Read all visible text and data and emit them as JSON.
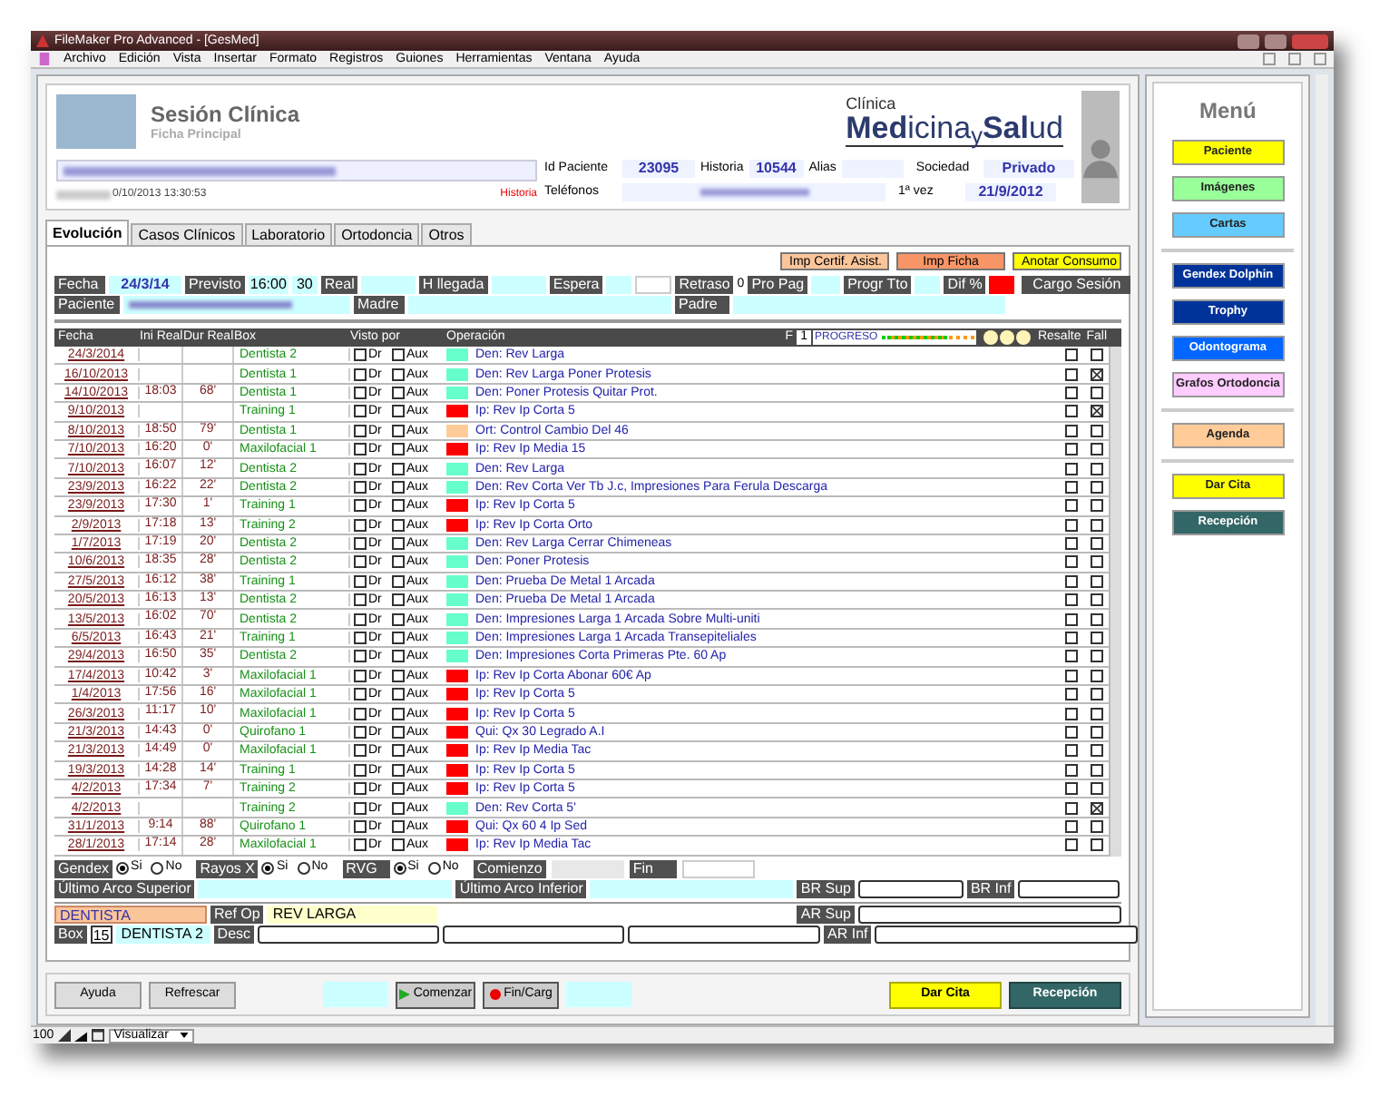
{
  "window": {
    "title": "FileMaker Pro Advanced - [GesMed]"
  },
  "menu_bar": [
    "Archivo",
    "Edición",
    "Vista",
    "Insertar",
    "Formato",
    "Registros",
    "Guiones",
    "Herramientas",
    "Ventana",
    "Ayuda"
  ],
  "header": {
    "title": "Sesión Clínica",
    "subtitle": "Ficha Principal",
    "clinic_label": "Clínica",
    "logo": "**Med**icina$_{y}$**Sal**ud",
    "timestamp": "0/10/2013 13:30:53",
    "history_link": "Historia",
    "id_paciente": {
      "label": "Id Paciente",
      "value": "23095"
    },
    "historia": {
      "label": "Historia",
      "value": "10544"
    },
    "alias": {
      "label": "Alias"
    },
    "sociedad": {
      "label": "Sociedad",
      "value": "Privado"
    },
    "telefonos": {
      "label": "Teléfonos"
    },
    "primera_vez": {
      "label": "1ª vez",
      "value": "21/9/2012"
    }
  },
  "tabs": [
    {
      "label": "Evolución",
      "selected": true
    },
    {
      "label": "Casos Clínicos",
      "selected": false
    },
    {
      "label": "Laboratorio",
      "selected": false
    },
    {
      "label": "Ortodoncia",
      "selected": false
    },
    {
      "label": "Otros",
      "selected": false
    }
  ],
  "action_buttons": [
    {
      "label": "Imp Certif. Asist.",
      "color": "#fbc59a"
    },
    {
      "label": "Imp Ficha",
      "color": "#f89566"
    },
    {
      "label": "Anotar Consumo",
      "color": "#ffff00"
    }
  ],
  "session": {
    "fecha": {
      "label": "Fecha",
      "value": "24/3/14"
    },
    "previsto": {
      "label": "Previsto",
      "time": "16:00",
      "minutes": "30"
    },
    "real": {
      "label": "Real"
    },
    "llegada": {
      "label": "H llegada"
    },
    "espera": {
      "label": "Espera"
    },
    "retraso": {
      "label": "Retraso",
      "value": "0"
    },
    "pro_pag": {
      "label": "Pro Pag"
    },
    "progr_tto": {
      "label": "Progr Tto"
    },
    "dif": {
      "label": "Dif %"
    },
    "cargo": {
      "label": "Cargo Sesión"
    },
    "paciente": {
      "label": "Paciente"
    },
    "madre": {
      "label": "Madre"
    },
    "padre": {
      "label": "Padre"
    }
  },
  "table": {
    "columns": [
      "Fecha",
      "Ini Real",
      "Dur Real",
      "Box",
      "Visto por",
      "Operación"
    ],
    "f_label": "F",
    "f_value": "1",
    "progress": {
      "label": "PROGRESO",
      "level": 0.7
    },
    "resalte": "Resalte",
    "fall": "Fall",
    "rows": [
      {
        "fecha": "24/3/2014",
        "ini": "",
        "dur": "",
        "box": "Dentista 2",
        "visto": [
          {
            "label": "Dr",
            "checked": false
          },
          {
            "label": "Aux",
            "checked": false
          }
        ],
        "color": "#66ffcc",
        "op": "Den: Rev Larga",
        "resalte": false,
        "fall": false
      },
      {
        "fecha": "16/10/2013",
        "ini": "",
        "dur": "",
        "box": "Dentista 1",
        "visto": [
          {
            "label": "Dr",
            "checked": false
          },
          {
            "label": "Aux",
            "checked": false
          }
        ],
        "color": "#66ffcc",
        "op": "Den: Rev Larga Poner Protesis",
        "resalte": false,
        "fall": true
      },
      {
        "fecha": "14/10/2013",
        "ini": "18:03",
        "dur": "68'",
        "box": "Dentista 1",
        "visto": [
          {
            "label": "Dr",
            "checked": false
          },
          {
            "label": "Aux",
            "checked": false
          }
        ],
        "color": "#66ffcc",
        "op": "Den: Poner Protesis  Quitar Prot.",
        "resalte": false,
        "fall": false
      },
      {
        "fecha": "9/10/2013",
        "ini": "",
        "dur": "",
        "box": "Training 1",
        "visto": [
          {
            "label": "Dr",
            "checked": false
          },
          {
            "label": "Aux",
            "checked": false
          }
        ],
        "color": "#ff0000",
        "op": "Ip: Rev Ip Corta 5",
        "resalte": false,
        "fall": true
      },
      {
        "fecha": "8/10/2013",
        "ini": "18:50",
        "dur": "79'",
        "box": "Dentista 1",
        "visto": [
          {
            "label": "Dr",
            "checked": false
          },
          {
            "label": "Aux",
            "checked": false
          }
        ],
        "color": "#ffcc99",
        "op": "Ort: Control Cambio Del 46",
        "resalte": false,
        "fall": false
      },
      {
        "fecha": "7/10/2013",
        "ini": "16:20",
        "dur": "0'",
        "box": "Maxilofacial 1",
        "visto": [
          {
            "label": "Dr",
            "checked": false
          },
          {
            "label": "Aux",
            "checked": false
          }
        ],
        "color": "#ff0000",
        "op": "Ip: Rev Ip Media 15",
        "resalte": false,
        "fall": false
      },
      {
        "fecha": "7/10/2013",
        "ini": "16:07",
        "dur": "12'",
        "box": "Dentista 2",
        "visto": [
          {
            "label": "Dr",
            "checked": false
          },
          {
            "label": "Aux",
            "checked": false
          }
        ],
        "color": "#66ffcc",
        "op": "Den: Rev Larga",
        "resalte": false,
        "fall": false
      },
      {
        "fecha": "23/9/2013",
        "ini": "16:22",
        "dur": "22'",
        "box": "Dentista 2",
        "visto": [
          {
            "label": "Dr",
            "checked": false
          },
          {
            "label": "Aux",
            "checked": false
          }
        ],
        "color": "#66ffcc",
        "op": "Den: Rev Corta Ver Tb J.c, Impresiones Para Ferula Descarga",
        "resalte": false,
        "fall": false
      },
      {
        "fecha": "23/9/2013",
        "ini": "17:30",
        "dur": "1'",
        "box": "Training 1",
        "visto": [
          {
            "label": "Dr",
            "checked": false
          },
          {
            "label": "Aux",
            "checked": false
          }
        ],
        "color": "#ff0000",
        "op": "Ip: Rev Ip Corta 5",
        "resalte": false,
        "fall": false
      },
      {
        "fecha": "2/9/2013",
        "ini": "17:18",
        "dur": "13'",
        "box": "Training 2",
        "visto": [
          {
            "label": "Dr",
            "checked": false
          },
          {
            "label": "Aux",
            "checked": false
          }
        ],
        "color": "#ff0000",
        "op": "Ip: Rev Ip Corta Orto",
        "resalte": false,
        "fall": false
      },
      {
        "fecha": "1/7/2013",
        "ini": "17:19",
        "dur": "20'",
        "box": "Dentista 2",
        "visto": [
          {
            "label": "Dr",
            "checked": false
          },
          {
            "label": "Aux",
            "checked": false
          }
        ],
        "color": "#66ffcc",
        "op": "Den: Rev Larga Cerrar Chimeneas",
        "resalte": false,
        "fall": false
      },
      {
        "fecha": "10/6/2013",
        "ini": "18:35",
        "dur": "28'",
        "box": "Dentista 2",
        "visto": [
          {
            "label": "Dr",
            "checked": false
          },
          {
            "label": "Aux",
            "checked": false
          }
        ],
        "color": "#66ffcc",
        "op": "Den: Poner Protesis",
        "resalte": false,
        "fall": false
      },
      {
        "fecha": "27/5/2013",
        "ini": "16:12",
        "dur": "38'",
        "box": "Training 1",
        "visto": [
          {
            "label": "Dr",
            "checked": false
          },
          {
            "label": "Aux",
            "checked": false
          }
        ],
        "color": "#66ffcc",
        "op": "Den: Prueba De Metal 1 Arcada",
        "resalte": false,
        "fall": false
      },
      {
        "fecha": "20/5/2013",
        "ini": "16:13",
        "dur": "13'",
        "box": "Dentista 2",
        "visto": [
          {
            "label": "Dr",
            "checked": false
          },
          {
            "label": "Aux",
            "checked": false
          }
        ],
        "color": "#66ffcc",
        "op": "Den: Prueba De Metal 1 Arcada",
        "resalte": false,
        "fall": false
      },
      {
        "fecha": "13/5/2013",
        "ini": "16:02",
        "dur": "70'",
        "box": "Dentista 2",
        "visto": [
          {
            "label": "Dr",
            "checked": false
          },
          {
            "label": "Aux",
            "checked": false
          }
        ],
        "color": "#66ffcc",
        "op": "Den: Impresiones Larga 1 Arcada Sobre Multi-uniti",
        "resalte": false,
        "fall": false
      },
      {
        "fecha": "6/5/2013",
        "ini": "16:43",
        "dur": "21'",
        "box": "Training 1",
        "visto": [
          {
            "label": "Dr",
            "checked": false
          },
          {
            "label": "Aux",
            "checked": false
          }
        ],
        "color": "#66ffcc",
        "op": "Den: Impresiones Larga 1 Arcada Transepiteliales",
        "resalte": false,
        "fall": false
      },
      {
        "fecha": "29/4/2013",
        "ini": "16:50",
        "dur": "35'",
        "box": "Dentista 2",
        "visto": [
          {
            "label": "Dr",
            "checked": false
          },
          {
            "label": "Aux",
            "checked": false
          }
        ],
        "color": "#66ffcc",
        "op": "Den: Impresiones Corta Primeras Pte. 60 Ap",
        "resalte": false,
        "fall": false
      },
      {
        "fecha": "17/4/2013",
        "ini": "10:42",
        "dur": "3'",
        "box": "Maxilofacial 1",
        "visto": [
          {
            "label": "Dr",
            "checked": false
          },
          {
            "label": "Aux",
            "checked": false
          }
        ],
        "color": "#ff0000",
        "op": "Ip: Rev Ip Corta Abonar 60€ Ap",
        "resalte": false,
        "fall": false
      },
      {
        "fecha": "1/4/2013",
        "ini": "17:56",
        "dur": "16'",
        "box": "Maxilofacial 1",
        "visto": [
          {
            "label": "Dr",
            "checked": false
          },
          {
            "label": "Aux",
            "checked": false
          }
        ],
        "color": "#ff0000",
        "op": "Ip: Rev Ip Corta 5",
        "resalte": false,
        "fall": false
      },
      {
        "fecha": "26/3/2013",
        "ini": "11:17",
        "dur": "10'",
        "box": "Maxilofacial 1",
        "visto": [
          {
            "label": "Dr",
            "checked": false
          },
          {
            "label": "Aux",
            "checked": false
          }
        ],
        "color": "#ff0000",
        "op": "Ip: Rev Ip Corta 5",
        "resalte": false,
        "fall": false
      },
      {
        "fecha": "21/3/2013",
        "ini": "14:43",
        "dur": "0'",
        "box": "Quirofano 1",
        "visto": [
          {
            "label": "Dr",
            "checked": false
          },
          {
            "label": "Aux",
            "checked": false
          }
        ],
        "color": "#ff0000",
        "op": "Qui: Qx 30 Legrado A.I",
        "resalte": false,
        "fall": false
      },
      {
        "fecha": "21/3/2013",
        "ini": "14:49",
        "dur": "0'",
        "box": "Maxilofacial 1",
        "visto": [
          {
            "label": "Dr",
            "checked": false
          },
          {
            "label": "Aux",
            "checked": false
          }
        ],
        "color": "#ff0000",
        "op": "Ip: Rev Ip Media Tac",
        "resalte": false,
        "fall": false
      },
      {
        "fecha": "19/3/2013",
        "ini": "14:28",
        "dur": "14'",
        "box": "Training 1",
        "visto": [
          {
            "label": "Dr",
            "checked": false
          },
          {
            "label": "Aux",
            "checked": false
          }
        ],
        "color": "#ff0000",
        "op": "Ip: Rev Ip Corta 5",
        "resalte": false,
        "fall": false
      },
      {
        "fecha": "4/2/2013",
        "ini": "17:34",
        "dur": "7'",
        "box": "Training 2",
        "visto": [
          {
            "label": "Dr",
            "checked": false
          },
          {
            "label": "Aux",
            "checked": false
          }
        ],
        "color": "#ff0000",
        "op": "Ip: Rev Ip Corta 5",
        "resalte": false,
        "fall": false
      },
      {
        "fecha": "4/2/2013",
        "ini": "",
        "dur": "",
        "box": "Training 2",
        "visto": [
          {
            "label": "Dr",
            "checked": false
          },
          {
            "label": "Aux",
            "checked": false
          }
        ],
        "color": "#66ffcc",
        "op": "Den: Rev Corta 5'",
        "resalte": false,
        "fall": true
      },
      {
        "fecha": "31/1/2013",
        "ini": "9:14",
        "dur": "88'",
        "box": "Quirofano 1",
        "visto": [
          {
            "label": "Dr",
            "checked": false
          },
          {
            "label": "Aux",
            "checked": false
          }
        ],
        "color": "#ff0000",
        "op": "Qui: Qx 60 4 Ip Sed",
        "resalte": false,
        "fall": false
      },
      {
        "fecha": "28/1/2013",
        "ini": "17:14",
        "dur": "28'",
        "box": "Maxilofacial 1",
        "visto": [
          {
            "label": "Dr",
            "checked": false
          },
          {
            "label": "Aux",
            "checked": false
          }
        ],
        "color": "#ff0000",
        "op": "Ip: Rev Ip Media Tac",
        "resalte": false,
        "fall": false
      }
    ]
  },
  "options": {
    "radios": [
      {
        "label": "Gendex",
        "choices": [
          {
            "label": "Si",
            "selected": true
          },
          {
            "label": "No",
            "selected": false
          }
        ]
      },
      {
        "label": "Rayos X",
        "choices": [
          {
            "label": "Si",
            "selected": true
          },
          {
            "label": "No",
            "selected": false
          }
        ]
      },
      {
        "label": "RVG",
        "choices": [
          {
            "label": "Si",
            "selected": true
          },
          {
            "label": "No",
            "selected": false
          }
        ]
      }
    ],
    "comienzo": "Comienzo",
    "fin": "Fin",
    "arco_superior": "Último Arco Superior",
    "arco_inferior": "Último Arco Inferior",
    "br_sup": "BR Sup",
    "br_inf": "BR Inf",
    "ar_sup": "AR Sup",
    "ar_inf": "AR Inf",
    "role": "DENTISTA",
    "ref_op": {
      "label": "Ref Op",
      "value": "REV LARGA"
    },
    "box": {
      "label": "Box",
      "number": "15",
      "name": "DENTISTA 2"
    },
    "desc": "Desc"
  },
  "footer_buttons": [
    {
      "label": "Ayuda",
      "kind": "plain"
    },
    {
      "label": "Refrescar",
      "kind": "plain"
    },
    {
      "label": "Comenzar",
      "kind": "play"
    },
    {
      "label": "Fin/Carg",
      "kind": "record"
    },
    {
      "label": "Dar Cita",
      "kind": "yellow"
    },
    {
      "label": "Recepción",
      "kind": "teal"
    }
  ],
  "side_menu": {
    "title": "Menú",
    "groups": [
      [
        {
          "label": "Paciente",
          "color": "#ffff00"
        },
        {
          "label": "Imágenes",
          "color": "#99ff99"
        },
        {
          "label": "Cartas",
          "color": "#66ccff"
        }
      ],
      [
        {
          "label": "Gendex Dolphin",
          "color": "#003399"
        },
        {
          "label": "Trophy",
          "color": "#003399"
        },
        {
          "label": "Odontograma",
          "color": "#0066ff"
        },
        {
          "label": "Grafos Ortodoncia",
          "color": "#ffccff"
        }
      ],
      [
        {
          "label": "Agenda",
          "color": "#ffcc99"
        }
      ],
      [
        {
          "label": "Dar Cita",
          "color": "#ffff00"
        },
        {
          "label": "Recepción",
          "color": "#336666"
        }
      ]
    ]
  },
  "status_bar": {
    "zoom": "100",
    "mode": "Visualizar"
  }
}
